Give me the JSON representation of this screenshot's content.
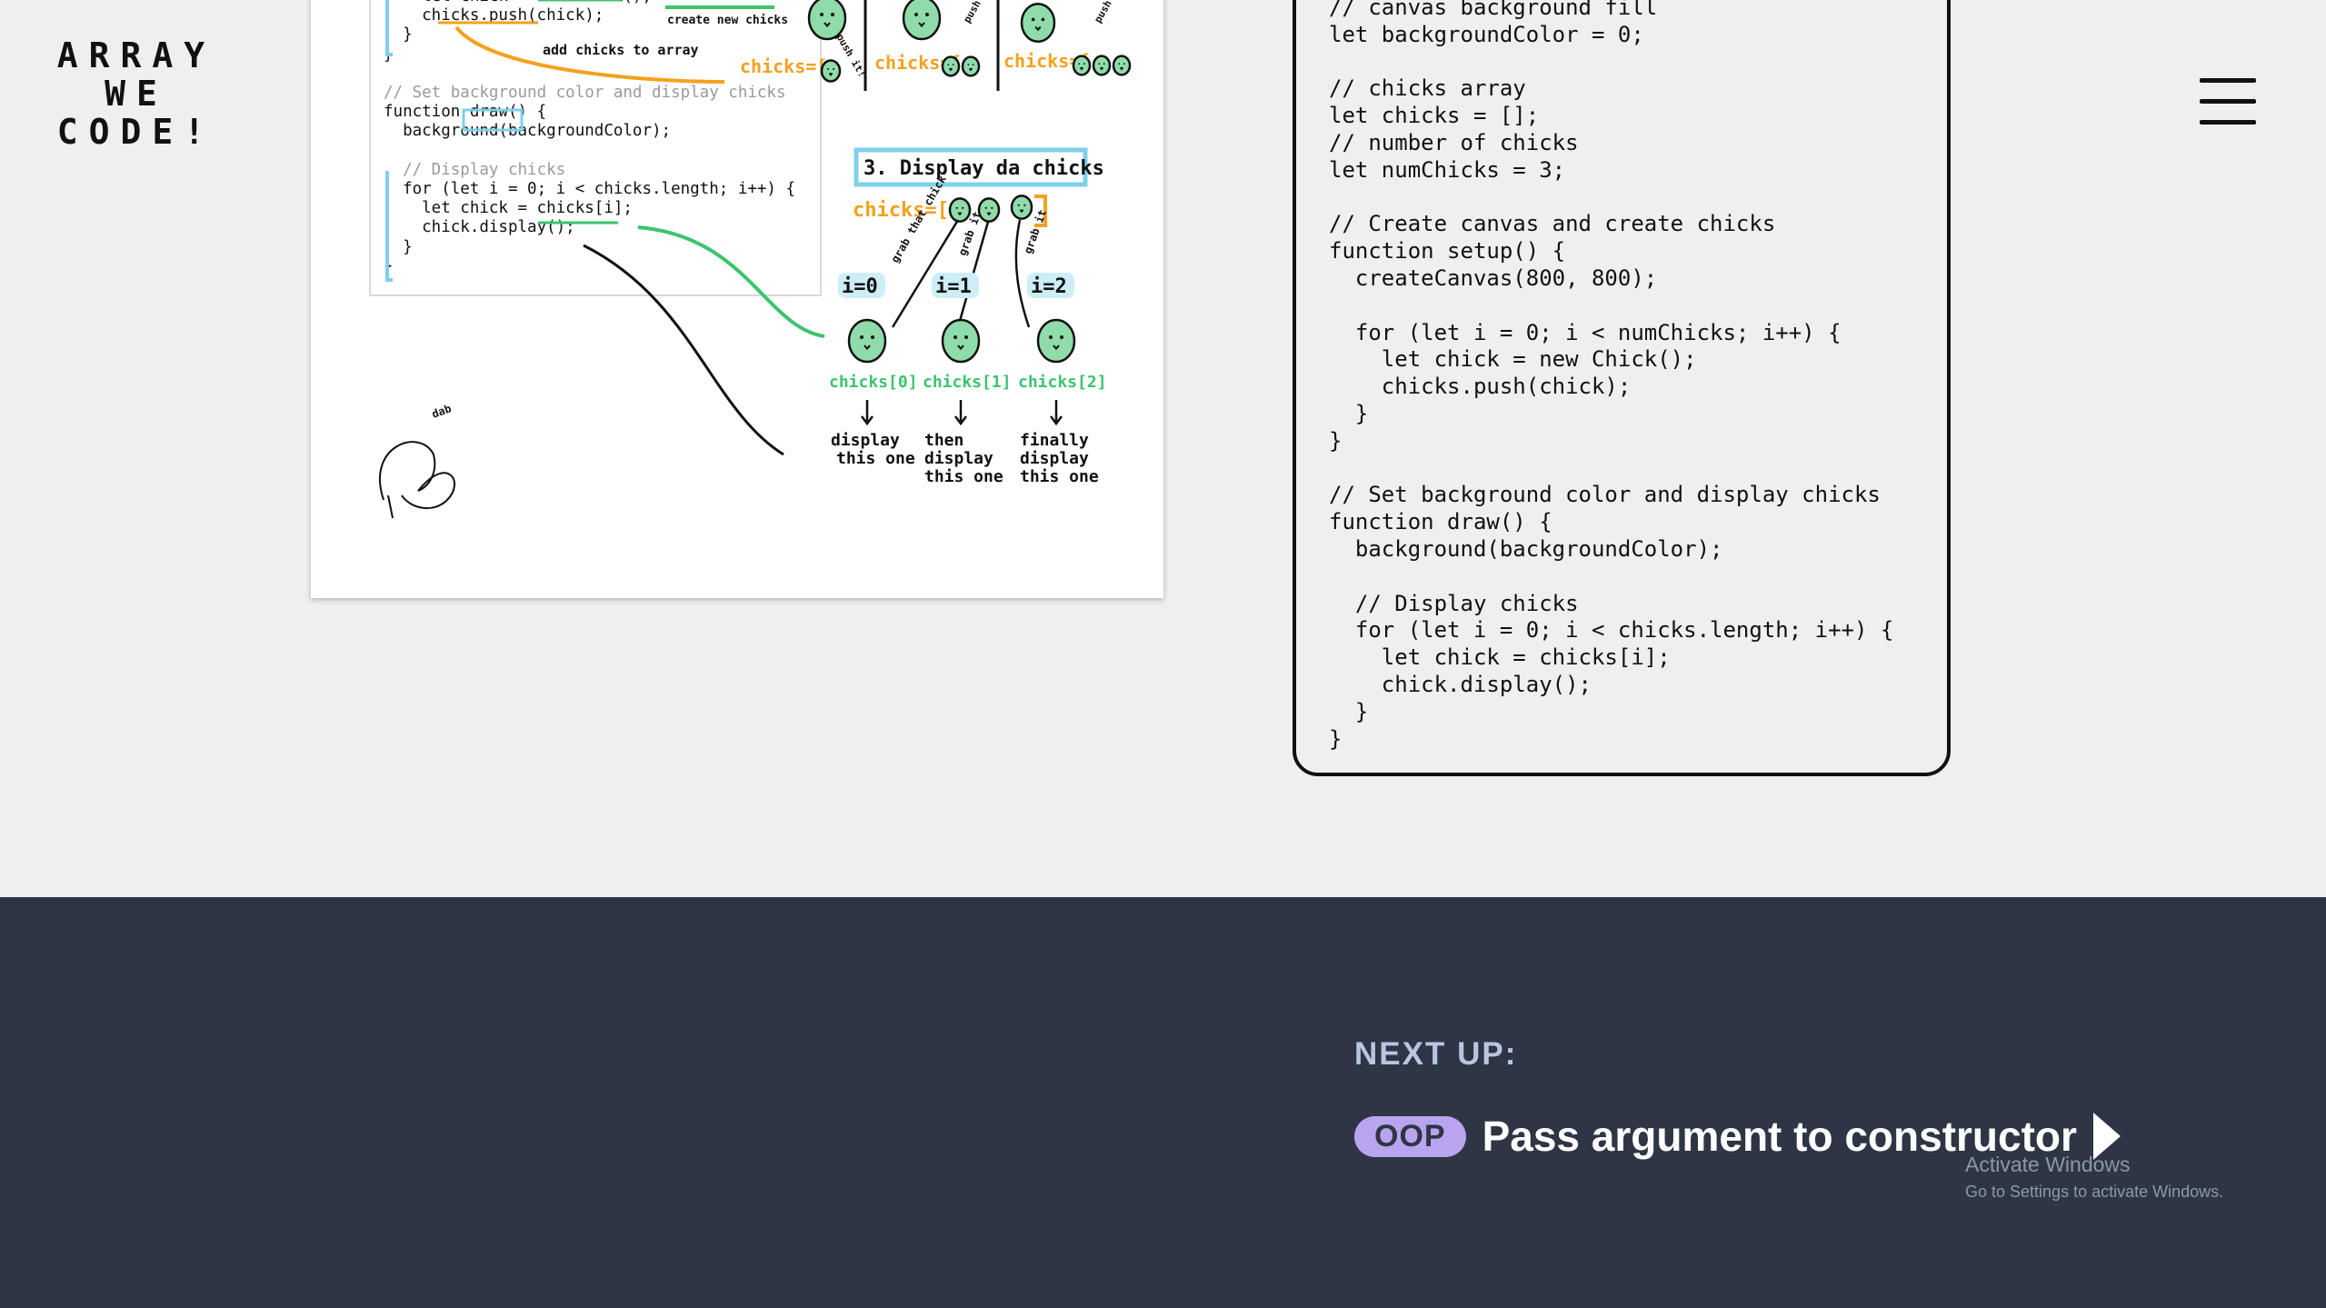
{
  "logo": {
    "line1": "ARRAY",
    "line2": "WE",
    "line3": "CODE!"
  },
  "menu": {
    "icon": "hamburger-menu-icon"
  },
  "sketch": {
    "code_lines": [
      {
        "text": "    let chick = new Chick();",
        "comment": false
      },
      {
        "text": "    chicks.push(chick);",
        "comment": false
      },
      {
        "text": "  }",
        "comment": false
      },
      {
        "text": "}",
        "comment": false
      },
      {
        "text": "",
        "comment": false
      },
      {
        "text": "// Set background color and display chicks",
        "comment": true
      },
      {
        "text": "function draw() {",
        "comment": false
      },
      {
        "text": "  background(backgroundColor);",
        "comment": false
      },
      {
        "text": "",
        "comment": false
      },
      {
        "text": "  // Display chicks",
        "comment": true
      },
      {
        "text": "  for (let i = 0; i < chicks.length; i++) {",
        "comment": false
      },
      {
        "text": "    let chick = chicks[i];",
        "comment": false
      },
      {
        "text": "    chick.display();",
        "comment": false
      },
      {
        "text": "  }",
        "comment": false
      },
      {
        "text": "}",
        "comment": false
      }
    ],
    "note_create": "create new chicks",
    "note_add": "add chicks to array",
    "chicks_eq": "chicks=[",
    "section_title": "3. Display da chicks",
    "grab_labels": [
      "grab that chick",
      "grab it",
      "grab it"
    ],
    "push_labels": [
      "push it!",
      "push it!",
      "push it!"
    ],
    "index_labels": [
      "i=0",
      "i=1",
      "i=2"
    ],
    "chick_labels": [
      "chicks[0]",
      "chicks[1]",
      "chicks[2]"
    ],
    "display_notes": [
      "display this one",
      "then display this one",
      "finally display this one"
    ],
    "signature": "dab",
    "colors": {
      "green": "#3cc46e",
      "orange": "#f4a11d",
      "teal": "#7fd0e8",
      "chick": "#8fdcaa"
    }
  },
  "code_panel": {
    "lines": [
      "// canvas background fill",
      "let backgroundColor = 0;",
      "",
      "// chicks array",
      "let chicks = [];",
      "// number of chicks",
      "let numChicks = 3;",
      "",
      "// Create canvas and create chicks",
      "function setup() {",
      "  createCanvas(800, 800);",
      "",
      "  for (let i = 0; i < numChicks; i++) {",
      "    let chick = new Chick();",
      "    chicks.push(chick);",
      "  }",
      "}",
      "",
      "// Set background color and display chicks",
      "function draw() {",
      "  background(backgroundColor);",
      "",
      "  // Display chicks",
      "  for (let i = 0; i < chicks.length; i++) {",
      "    let chick = chicks[i];",
      "    chick.display();",
      "  }",
      "}"
    ]
  },
  "footer": {
    "next_label": "NEXT UP:",
    "badge": "OOP",
    "next_title": "Pass argument to constructor",
    "next_icon": "play-arrow-icon",
    "bg": "#2e3545",
    "badge_color": "#b9a5ef"
  },
  "watermark": {
    "line1": "Activate Windows",
    "line2": "Go to Settings to activate Windows."
  }
}
